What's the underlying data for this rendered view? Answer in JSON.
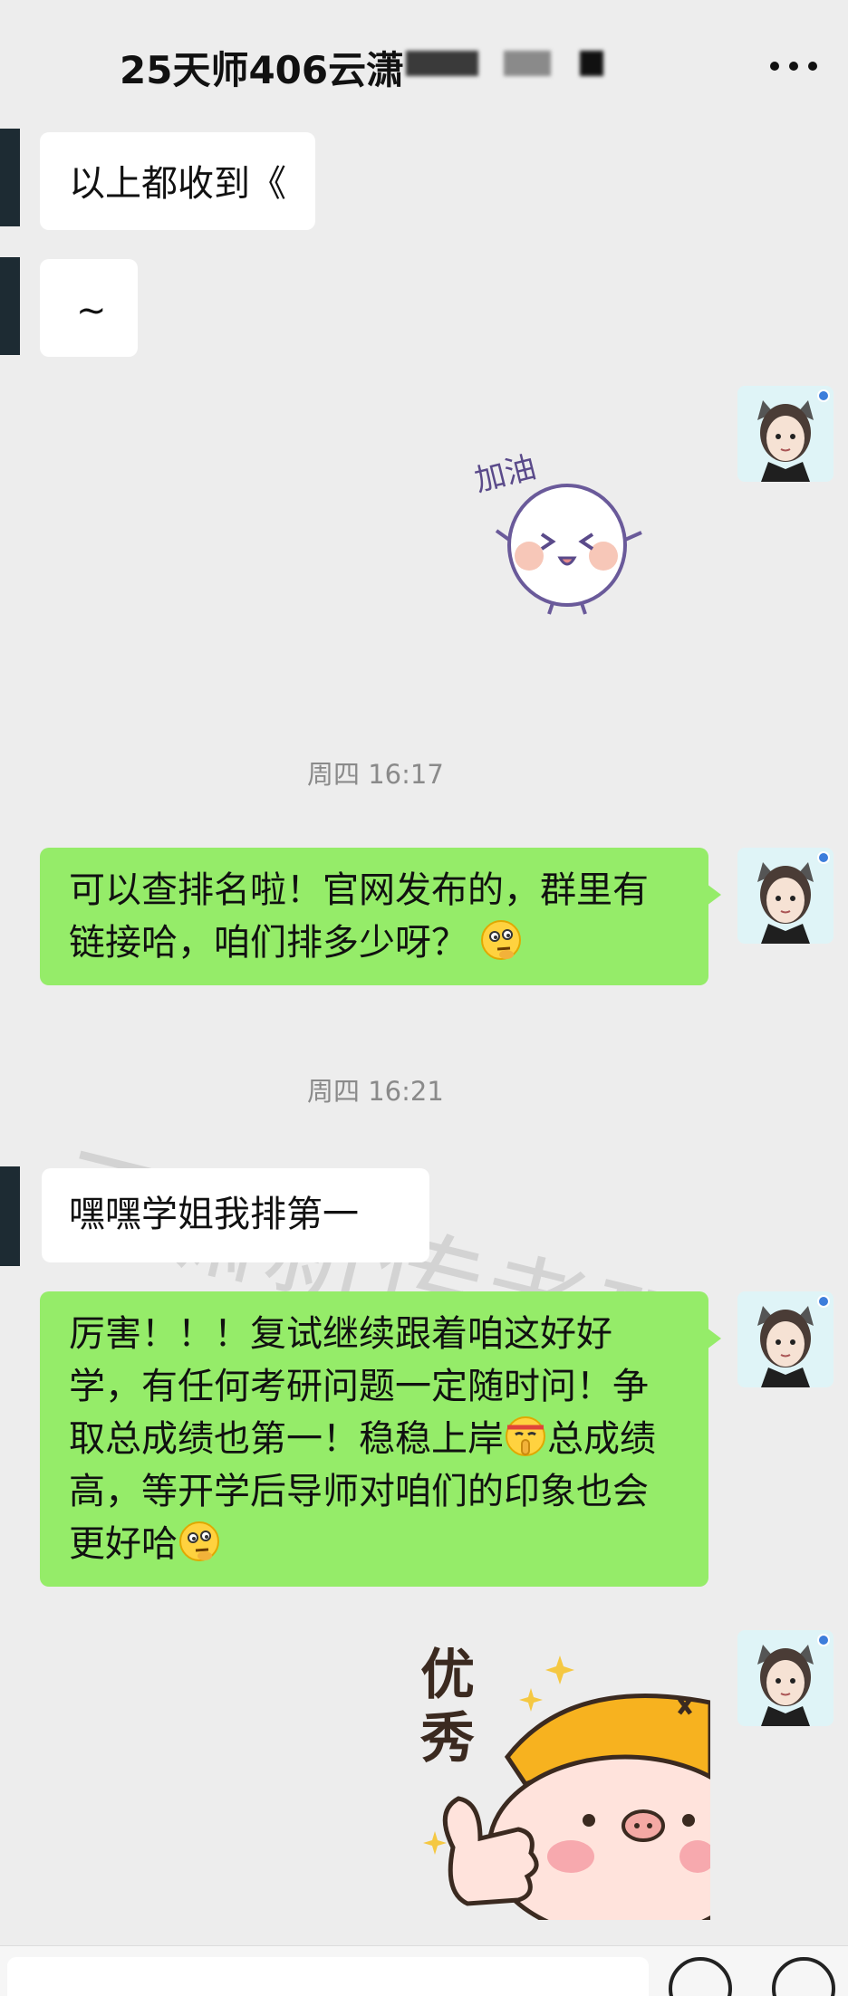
{
  "header": {
    "title": "25天师406云潇"
  },
  "messages": {
    "m1": "以上都收到《",
    "m2": "~",
    "t1": "周四 16:17",
    "m3": "可以查排名啦！官网发布的，群里有链接哈，咱们排多少呀？",
    "t2": "周四 16:21",
    "m4": "嘿嘿学姐我排第一",
    "m5a": "厉害！！！复试继续跟着咱这好好学，有任何考研问题一定随时问！争取总成绩也第一！稳稳上岸",
    "m5b": "总成绩高，等开学后导师对咱们的印象也会更好哈"
  },
  "stickers": {
    "s1_text": "加油",
    "s2_text_1": "优",
    "s2_text_2": "秀"
  },
  "watermark": "云潇新传考研",
  "icons": {
    "more": "more-icon",
    "emoji_thinking": "thinking-face-icon",
    "emoji_shush": "shushing-face-icon"
  },
  "colors": {
    "background": "#ededed",
    "sent_bubble": "#95ec69",
    "received_bubble": "#ffffff"
  }
}
